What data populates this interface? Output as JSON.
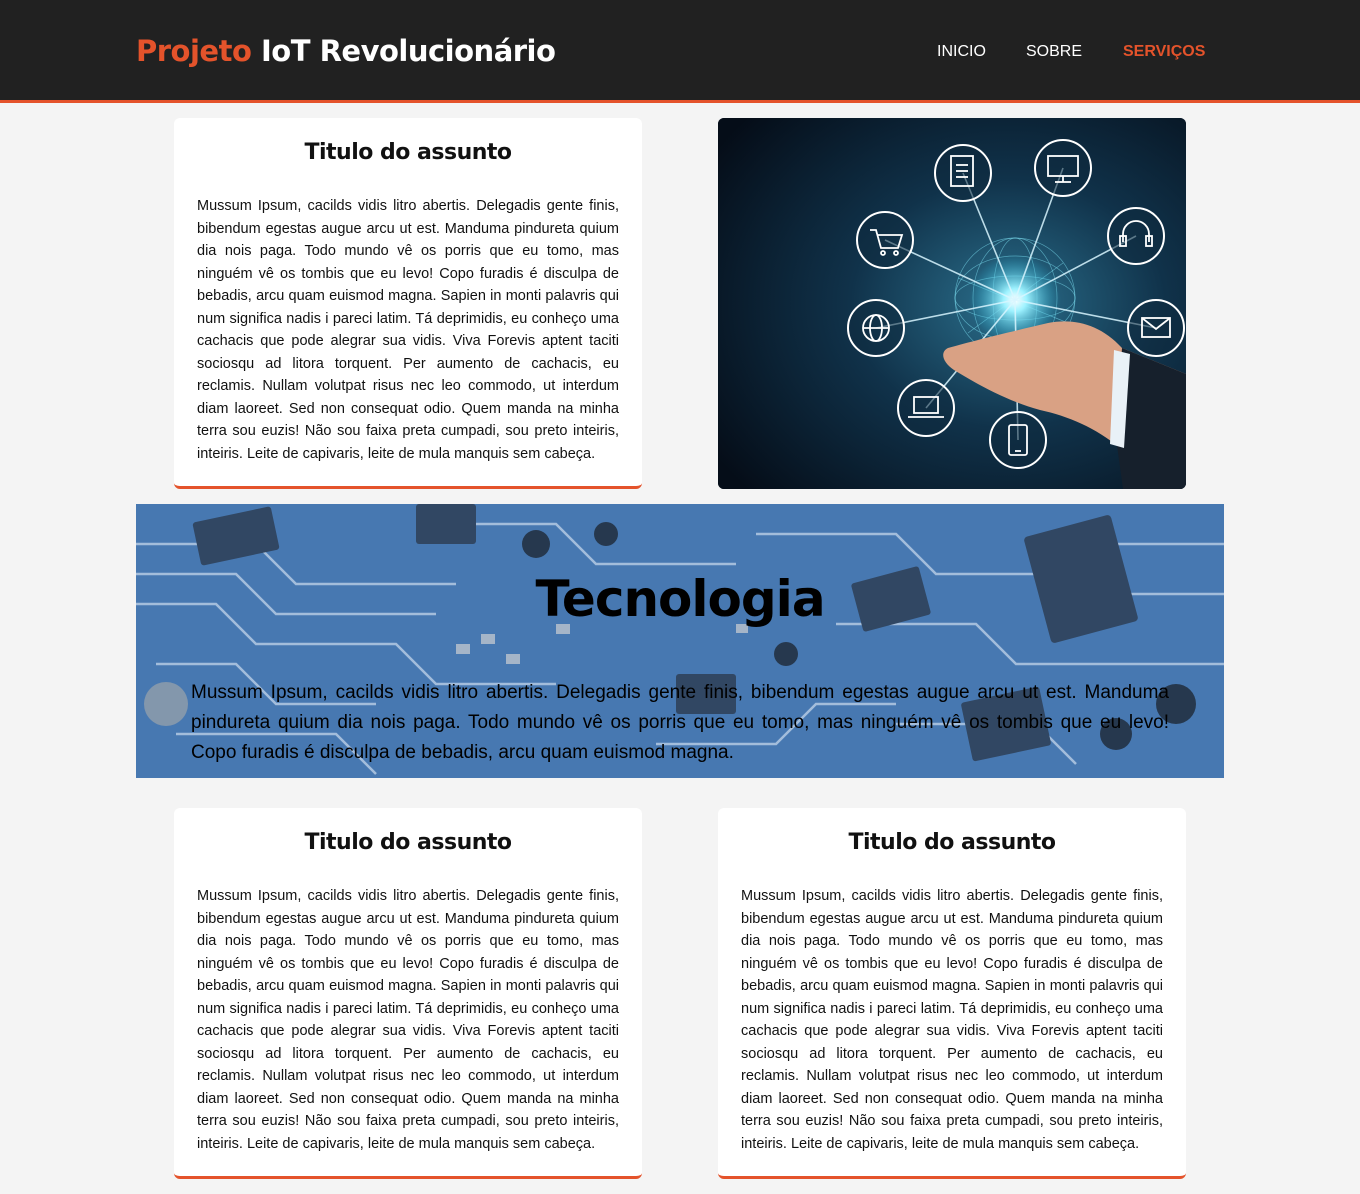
{
  "header": {
    "brand_accent": "Projeto",
    "brand_rest": "IoT Revolucionário",
    "nav": [
      {
        "label": "INICIO",
        "active": false
      },
      {
        "label": "SOBRE",
        "active": false
      },
      {
        "label": "SERVIÇOS",
        "active": true
      }
    ]
  },
  "colors": {
    "accent": "#e4532b",
    "header_bg": "#212121",
    "page_bg": "#f4f4f4",
    "card_bg": "#ffffff",
    "banner_tint": "#3f6ea6"
  },
  "cards": [
    {
      "title": "Titulo do assunto",
      "text": "Mussum Ipsum, cacilds vidis litro abertis. Delegadis gente finis, bibendum egestas augue arcu ut est. Manduma pindureta quium dia nois paga. Todo mundo vê os porris que eu tomo, mas ninguém vê os tombis que eu levo! Copo furadis é disculpa de bebadis, arcu quam euismod magna. Sapien in monti palavris qui num significa nadis i pareci latim. Tá deprimidis, eu conheço uma cachacis que pode alegrar sua vidis. Viva Forevis aptent taciti sociosqu ad litora torquent. Per aumento de cachacis, eu reclamis. Nullam volutpat risus nec leo commodo, ut interdum diam laoreet. Sed non consequat odio. Quem manda na minha terra sou euzis! Não sou faixa preta cumpadi, sou preto inteiris, inteiris. Leite de capivaris, leite de mula manquis sem cabeça."
    },
    {
      "title": "Titulo do assunto",
      "text": "Mussum Ipsum, cacilds vidis litro abertis. Delegadis gente finis, bibendum egestas augue arcu ut est. Manduma pindureta quium dia nois paga. Todo mundo vê os porris que eu tomo, mas ninguém vê os tombis que eu levo! Copo furadis é disculpa de bebadis, arcu quam euismod magna. Sapien in monti palavris qui num significa nadis i pareci latim. Tá deprimidis, eu conheço uma cachacis que pode alegrar sua vidis. Viva Forevis aptent taciti sociosqu ad litora torquent. Per aumento de cachacis, eu reclamis. Nullam volutpat risus nec leo commodo, ut interdum diam laoreet. Sed non consequat odio. Quem manda na minha terra sou euzis! Não sou faixa preta cumpadi, sou preto inteiris, inteiris. Leite de capivaris, leite de mula manquis sem cabeça."
    },
    {
      "title": "Titulo do assunto",
      "text": "Mussum Ipsum, cacilds vidis litro abertis. Delegadis gente finis, bibendum egestas augue arcu ut est. Manduma pindureta quium dia nois paga. Todo mundo vê os porris que eu tomo, mas ninguém vê os tombis que eu levo! Copo furadis é disculpa de bebadis, arcu quam euismod magna. Sapien in monti palavris qui num significa nadis i pareci latim. Tá deprimidis, eu conheço uma cachacis que pode alegrar sua vidis. Viva Forevis aptent taciti sociosqu ad litora torquent. Per aumento de cachacis, eu reclamis. Nullam volutpat risus nec leo commodo, ut interdum diam laoreet. Sed non consequat odio. Quem manda na minha terra sou euzis! Não sou faixa preta cumpadi, sou preto inteiris, inteiris. Leite de capivaris, leite de mula manquis sem cabeça."
    }
  ],
  "hero_image": {
    "icons": [
      "document-icon",
      "monitor-icon",
      "cart-icon",
      "headset-icon",
      "globe-icon",
      "mail-icon",
      "laptop-icon",
      "phone-icon",
      "hand-icon"
    ]
  },
  "banner": {
    "title": "Tecnologia",
    "text": "Mussum Ipsum, cacilds vidis litro abertis. Delegadis gente finis, bibendum egestas augue arcu ut est. Manduma pindureta quium dia nois paga. Todo mundo vê os porris que eu tomo, mas ninguém vê os tombis que eu levo! Copo furadis é disculpa de bebadis, arcu quam euismod magna."
  }
}
